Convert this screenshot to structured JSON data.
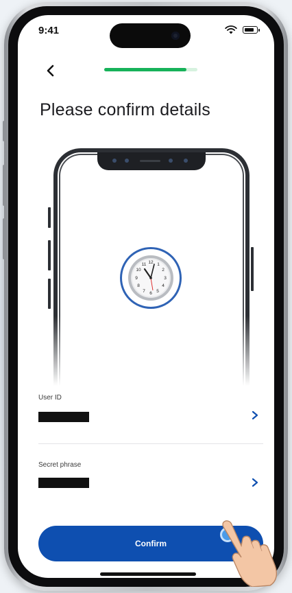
{
  "status_bar": {
    "time": "9:41",
    "icons": [
      "wifi-icon",
      "battery-icon"
    ]
  },
  "nav": {
    "back_icon": "chevron-left-icon",
    "progress": 0.88
  },
  "page": {
    "title": "Please confirm details"
  },
  "illustration": {
    "icon": "wall-clock-icon",
    "ring_color": "#2f63b5"
  },
  "fields": [
    {
      "label": "User ID",
      "value": "[redacted]",
      "action_icon": "chevron-right-icon"
    },
    {
      "label": "Secret phrase",
      "value": "[redacted]",
      "action_icon": "chevron-right-icon"
    }
  ],
  "confirm": {
    "label": "Confirm",
    "color": "#0e4fb0"
  },
  "colors": {
    "accent": "#0e4fb0",
    "progress": "#17b25a",
    "progress_track": "#d6f2df"
  }
}
